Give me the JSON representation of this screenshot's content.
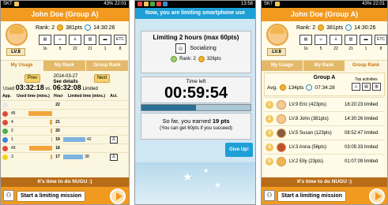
{
  "screen1": {
    "status": {
      "carrier": "SKT",
      "signal": "43%",
      "time": "22:01"
    },
    "header_title": "John Doe (Group A)",
    "level": "LV.8",
    "rank_label": "Rank: 2",
    "points": "381pts",
    "time_total": "14:30:26",
    "activity_counts": [
      "1k",
      "5",
      "22",
      "21",
      "1",
      "8"
    ],
    "activity_labels": [
      "",
      "",
      "",
      "",
      "",
      "ETC"
    ],
    "tabs": [
      "My Usage",
      "My Rank",
      "Group Rank"
    ],
    "prev_label": "Prev",
    "next_label": "Next",
    "date": "2014-03-27",
    "see_details": "See details",
    "used_prefix": "Used",
    "used_time": "03:32:18",
    "vs_label": "vs.",
    "limited_time": "06:32:08",
    "limited_suffix": "Limited",
    "table_headers": {
      "app": "App.",
      "used": "Used time (mins.)",
      "hour": "Hour",
      "limited": "Limited time (mins.)",
      "act": "Act."
    },
    "rows": [
      {
        "used": "",
        "hour": "22",
        "limited": "",
        "used_frac": 0.0,
        "limited_frac": 0.0
      },
      {
        "used": "45",
        "hour": "",
        "limited": "",
        "used_frac": 0.75,
        "limited_frac": 0.0
      },
      {
        "used": "4",
        "hour": "21",
        "limited": "",
        "used_frac": 0.07,
        "limited_frac": 0.0
      },
      {
        "used": "2",
        "hour": "20",
        "limited": "",
        "used_frac": 0.04,
        "limited_frac": 0.0
      },
      {
        "used": "1",
        "hour": "19",
        "limited": "42",
        "used_frac": 0.02,
        "limited_frac": 0.7
      },
      {
        "used": "43",
        "hour": "18",
        "limited": "",
        "used_frac": 0.72,
        "limited_frac": 0.0
      },
      {
        "used": "3",
        "hour": "17",
        "limited": "38",
        "used_frac": 0.05,
        "limited_frac": 0.63
      }
    ],
    "bottom_message": "It's time to do NUGU :)",
    "start_button": "Start a limiting mission"
  },
  "screen2": {
    "status": {
      "time": "13:58"
    },
    "header_banner": "Now, you are limiting smartphone use",
    "limit_title": "Limiting 2 hours (max 60pts)",
    "activity": "Socializing",
    "rank_label": "Rank: 2",
    "points": "326pts",
    "time_left_label": "Time left",
    "countdown": "00:59:54",
    "progress_fraction": 0.5,
    "earned_prefix": "So far, you earned",
    "earned_pts": "19 pts",
    "success_note": "(You can get 60pts if you succeed)",
    "give_up": "Give Up!"
  },
  "screen3": {
    "status": {
      "carrier": "SKT",
      "signal": "43%",
      "time": "22:01"
    },
    "header_title": "John Doe (Group A)",
    "level": "LV.8",
    "rank_label": "Rank: 2",
    "points": "381pts",
    "time_total": "14:30:26",
    "activity_counts": [
      "1k",
      "5",
      "22",
      "21",
      "1",
      "8"
    ],
    "tabs": [
      "My Usage",
      "My Rank",
      "Group Rank"
    ],
    "group_name": "Group A",
    "avg_label": "Avg.",
    "avg_points": "134pts",
    "avg_time": "07:34:28",
    "top_activities": "Top activities",
    "members": [
      {
        "rank": "1",
        "name": "LV.9 Eric (423pts)",
        "time": "18:20:23 limited"
      },
      {
        "rank": "2",
        "name": "LV.8 John (381pts)",
        "time": "14:30:26 limited"
      },
      {
        "rank": "3",
        "name": "LV.5 Susan (123pts)",
        "time": "08:52:47 limited"
      },
      {
        "rank": "4",
        "name": "LV.3 Anna (56pts)",
        "time": "03:05:33 limited"
      },
      {
        "rank": "5",
        "name": "LV.2 Elly (23pts)",
        "time": "01:07:09 limited"
      }
    ],
    "bottom_message": "It's time to do NUGU :)",
    "start_button": "Start a limiting mission"
  }
}
